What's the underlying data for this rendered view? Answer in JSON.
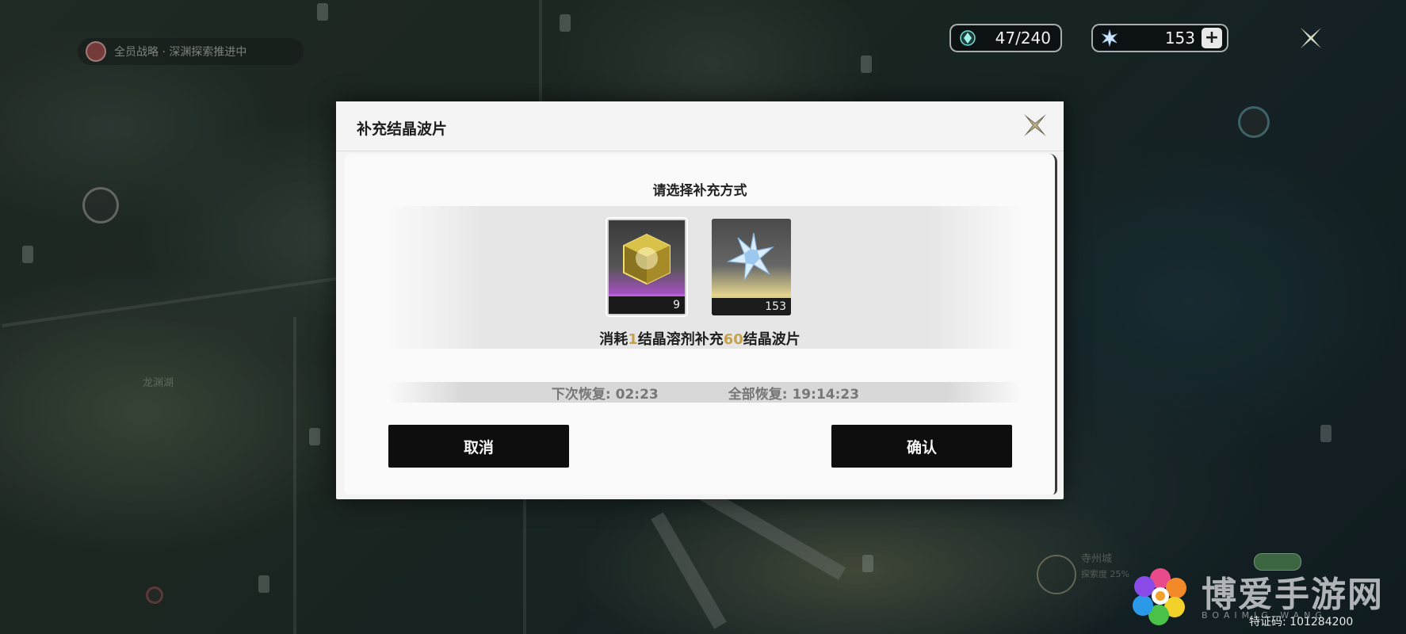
{
  "map": {
    "quest_text": "全员战略 · 深渊探索推进中",
    "label_1": "龙渊湖",
    "label_2": "寺州城",
    "label_3": "探索度 25%"
  },
  "hud": {
    "energy_icon": "crystal-gem-icon",
    "energy_value": "47/240",
    "shard_icon": "crystal-star-icon",
    "shard_value": "153",
    "plus_label": "+",
    "close_icon": "close-x-icon"
  },
  "dialog": {
    "title": "补充结晶波片",
    "prompt": "请选择补充方式",
    "items": [
      {
        "name": "crystal-solvent",
        "count": "9",
        "icon": "golden-cube-icon"
      },
      {
        "name": "crystal-star",
        "count": "153",
        "icon": "blue-crystal-star-icon"
      }
    ],
    "desc_part1": "消耗",
    "desc_num1": "1",
    "desc_part2": "结晶溶剂补充",
    "desc_num2": "60",
    "desc_part3": "结晶波片",
    "next_recover": "下次恢复: 02:23",
    "full_recover": "全部恢复: 19:14:23",
    "cancel_label": "取消",
    "confirm_label": "确认"
  },
  "watermark": {
    "text": "博爱手游网",
    "sub": "BOAIMIG WANG",
    "verify": "特证码: 101284200"
  },
  "colors": {
    "highlight": "#c6a24a",
    "button_bg": "#0e0e0e",
    "rarity_purple": "#c060e0",
    "rarity_gold": "#e0cf80"
  }
}
